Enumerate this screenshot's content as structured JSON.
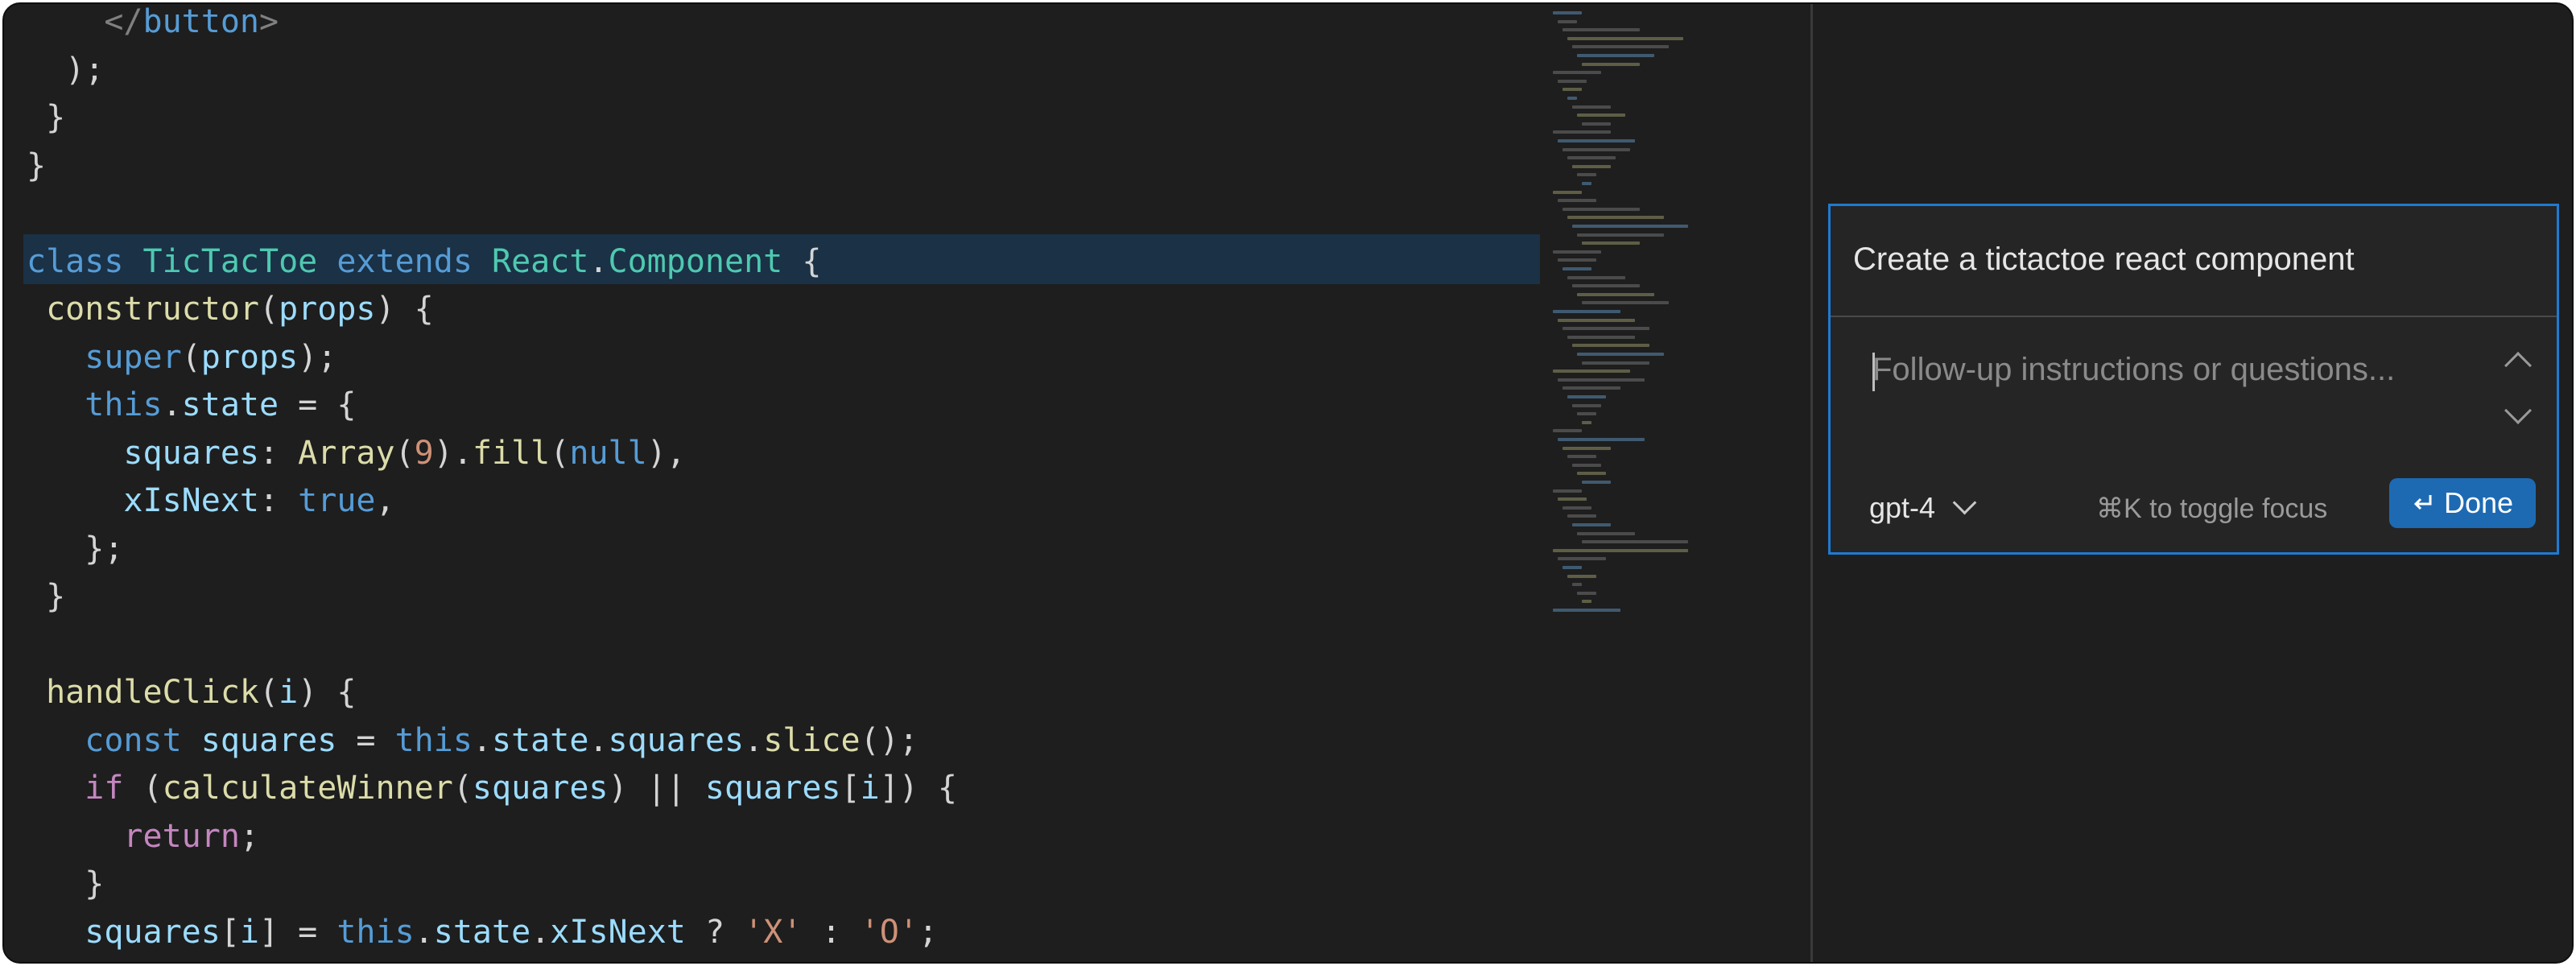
{
  "editor": {
    "lines": [
      {
        "segments": [
          {
            "t": "    ",
            "c": "pun"
          },
          {
            "t": "</",
            "c": "tag"
          },
          {
            "t": "button",
            "c": "tagname"
          },
          {
            "t": ">",
            "c": "tag"
          }
        ]
      },
      {
        "segments": [
          {
            "t": "  );",
            "c": "pun"
          }
        ]
      },
      {
        "segments": [
          {
            "t": " }",
            "c": "pun"
          }
        ]
      },
      {
        "segments": [
          {
            "t": "}",
            "c": "pun"
          }
        ]
      },
      {
        "segments": []
      },
      {
        "segments": [
          {
            "t": "class ",
            "c": "kw"
          },
          {
            "t": "TicTacToe",
            "c": "cls"
          },
          {
            "t": " extends ",
            "c": "kw"
          },
          {
            "t": "React",
            "c": "cls"
          },
          {
            "t": ".",
            "c": "pun"
          },
          {
            "t": "Component",
            "c": "cls"
          },
          {
            "t": " {",
            "c": "pun"
          }
        ]
      },
      {
        "segments": [
          {
            "t": " constructor",
            "c": "fn"
          },
          {
            "t": "(",
            "c": "pun"
          },
          {
            "t": "props",
            "c": "var"
          },
          {
            "t": ") {",
            "c": "pun"
          }
        ]
      },
      {
        "segments": [
          {
            "t": "   super",
            "c": "kw"
          },
          {
            "t": "(",
            "c": "pun"
          },
          {
            "t": "props",
            "c": "var"
          },
          {
            "t": ");",
            "c": "pun"
          }
        ]
      },
      {
        "segments": [
          {
            "t": "   this",
            "c": "kw"
          },
          {
            "t": ".",
            "c": "pun"
          },
          {
            "t": "state",
            "c": "var"
          },
          {
            "t": " = {",
            "c": "pun"
          }
        ]
      },
      {
        "segments": [
          {
            "t": "     squares",
            "c": "var"
          },
          {
            "t": ": ",
            "c": "pun"
          },
          {
            "t": "Array",
            "c": "fn"
          },
          {
            "t": "(",
            "c": "pun"
          },
          {
            "t": "9",
            "c": "str"
          },
          {
            "t": ").",
            "c": "pun"
          },
          {
            "t": "fill",
            "c": "fn"
          },
          {
            "t": "(",
            "c": "pun"
          },
          {
            "t": "null",
            "c": "kw"
          },
          {
            "t": "),",
            "c": "pun"
          }
        ]
      },
      {
        "segments": [
          {
            "t": "     xIsNext",
            "c": "var"
          },
          {
            "t": ": ",
            "c": "pun"
          },
          {
            "t": "true",
            "c": "kw"
          },
          {
            "t": ",",
            "c": "pun"
          }
        ]
      },
      {
        "segments": [
          {
            "t": "   };",
            "c": "pun"
          }
        ]
      },
      {
        "segments": [
          {
            "t": " }",
            "c": "pun"
          }
        ]
      },
      {
        "segments": []
      },
      {
        "segments": [
          {
            "t": " handleClick",
            "c": "fn"
          },
          {
            "t": "(",
            "c": "pun"
          },
          {
            "t": "i",
            "c": "var"
          },
          {
            "t": ") {",
            "c": "pun"
          }
        ]
      },
      {
        "segments": [
          {
            "t": "   const ",
            "c": "kw"
          },
          {
            "t": "squares",
            "c": "var"
          },
          {
            "t": " = ",
            "c": "pun"
          },
          {
            "t": "this",
            "c": "kw"
          },
          {
            "t": ".",
            "c": "pun"
          },
          {
            "t": "state",
            "c": "var"
          },
          {
            "t": ".",
            "c": "pun"
          },
          {
            "t": "squares",
            "c": "var"
          },
          {
            "t": ".",
            "c": "pun"
          },
          {
            "t": "slice",
            "c": "fn"
          },
          {
            "t": "();",
            "c": "pun"
          }
        ]
      },
      {
        "segments": [
          {
            "t": "   if",
            "c": "kw2"
          },
          {
            "t": " (",
            "c": "pun"
          },
          {
            "t": "calculateWinner",
            "c": "fn"
          },
          {
            "t": "(",
            "c": "pun"
          },
          {
            "t": "squares",
            "c": "var"
          },
          {
            "t": ") || ",
            "c": "pun"
          },
          {
            "t": "squares",
            "c": "var"
          },
          {
            "t": "[",
            "c": "pun"
          },
          {
            "t": "i",
            "c": "var"
          },
          {
            "t": "]) {",
            "c": "pun"
          }
        ]
      },
      {
        "segments": [
          {
            "t": "     return",
            "c": "kw2"
          },
          {
            "t": ";",
            "c": "pun"
          }
        ]
      },
      {
        "segments": [
          {
            "t": "   }",
            "c": "pun"
          }
        ]
      },
      {
        "segments": [
          {
            "t": "   squares",
            "c": "var"
          },
          {
            "t": "[",
            "c": "pun"
          },
          {
            "t": "i",
            "c": "var"
          },
          {
            "t": "] = ",
            "c": "pun"
          },
          {
            "t": "this",
            "c": "kw"
          },
          {
            "t": ".",
            "c": "pun"
          },
          {
            "t": "state",
            "c": "var"
          },
          {
            "t": ".",
            "c": "pun"
          },
          {
            "t": "xIsNext",
            "c": "var"
          },
          {
            "t": " ? ",
            "c": "pun"
          },
          {
            "t": "'X'",
            "c": "str"
          },
          {
            "t": " : ",
            "c": "pun"
          },
          {
            "t": "'O'",
            "c": "str"
          },
          {
            "t": ";",
            "c": "pun"
          }
        ]
      }
    ]
  },
  "panel": {
    "prompt": "Create a tictactoe react component",
    "followup_placeholder": "Follow-up instructions or questions...",
    "model": "gpt-4",
    "hint": "⌘K to toggle focus",
    "done_label": "Done"
  }
}
